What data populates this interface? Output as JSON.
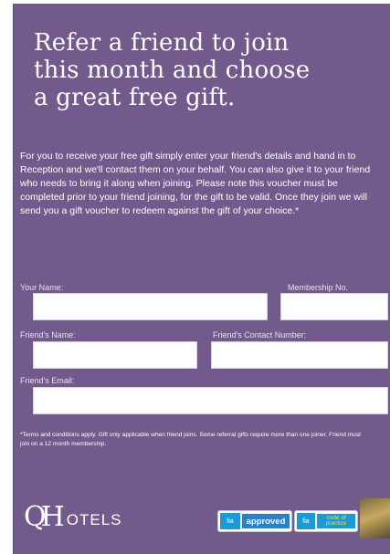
{
  "headline": [
    "Refer a friend to join",
    "this month and choose",
    "a great free gift."
  ],
  "intro": "For you to receive your free gift simply enter your friend's details and hand in to Reception and we'll contact them on your behalf. You can also give it to your friend who needs to bring it along when joining. Please note this voucher must be completed prior to your friend joining, for the gift to be valid. Once they join we will send you a gift voucher to redeem against the gift of your choice.*",
  "form": {
    "your_name_label": "Your Name:",
    "membership_label": "Membership No.",
    "friend_name_label": "Friend's Name:",
    "friend_contact_label": "Friend's Contact Number:",
    "friend_email_label": "Friend's Email:"
  },
  "terms": "*Terms and conditions apply. Gift only applicable when friend joins. Some referral gifts require more than one joiner. Friend must join on a 12 month membership.",
  "logo": {
    "mark": "QH",
    "word": "OTELS"
  },
  "badges": {
    "fia": "fia",
    "approved": "approved",
    "code_line1": "code of",
    "code_line2": "practice"
  },
  "colors": {
    "background": "#735a8c",
    "text": "#ffffff",
    "badge_blue": "#2c80c6"
  }
}
